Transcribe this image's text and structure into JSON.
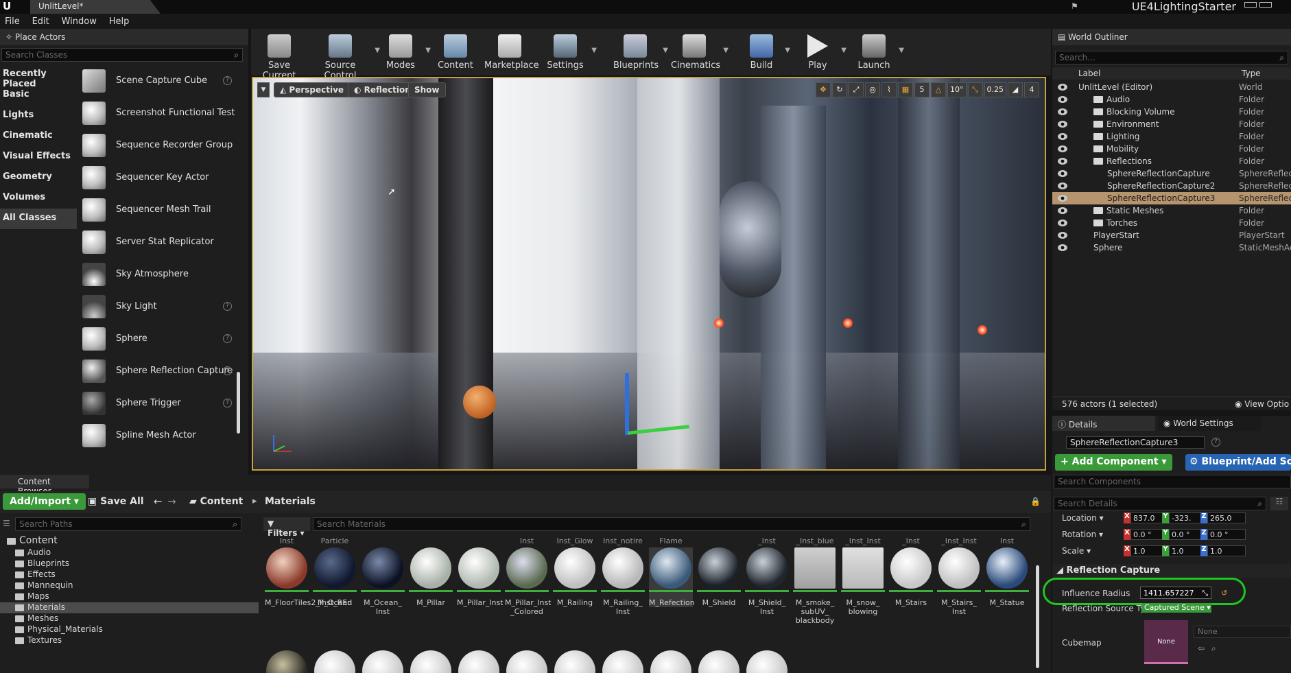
{
  "titlebar": {
    "tab": "UnlitLevel*",
    "project": "UE4LightingStarter"
  },
  "menu": [
    "File",
    "Edit",
    "Window",
    "Help"
  ],
  "place_actors": {
    "title": "Place Actors",
    "search_placeholder": "Search Classes",
    "categories": [
      "Recently Placed",
      "Basic",
      "Lights",
      "Cinematic",
      "Visual Effects",
      "Geometry",
      "Volumes",
      "All Classes"
    ],
    "items": [
      "Scene Capture Cube",
      "Screenshot Functional Test",
      "Sequence Recorder Group",
      "Sequencer Key Actor",
      "Sequencer Mesh Trail",
      "Server Stat Replicator",
      "Sky Atmosphere",
      "Sky Light",
      "Sphere",
      "Sphere Reflection Capture",
      "Sphere Trigger",
      "Spline Mesh Actor"
    ]
  },
  "toolbar": [
    "Save Current",
    "Source Control",
    "Modes",
    "Content",
    "Marketplace",
    "Settings",
    "Blueprints",
    "Cinematics",
    "Build",
    "Play",
    "Launch"
  ],
  "viewport": {
    "perspective": "Perspective",
    "reflections": "Reflections",
    "show": "Show",
    "grid": "5",
    "angle": "10°",
    "scale": "0.25",
    "cam_speed": "4"
  },
  "world_outliner": {
    "title": "World Outliner",
    "search_placeholder": "Search...",
    "col_label": "Label",
    "col_type": "Type",
    "rows": [
      {
        "label": "UnlitLevel (Editor)",
        "type": "World"
      },
      {
        "label": "Audio",
        "type": "Folder"
      },
      {
        "label": "Blocking Volume",
        "type": "Folder"
      },
      {
        "label": "Environment",
        "type": "Folder"
      },
      {
        "label": "Lighting",
        "type": "Folder"
      },
      {
        "label": "Mobility",
        "type": "Folder"
      },
      {
        "label": "Reflections",
        "type": "Folder"
      },
      {
        "label": "SphereReflectionCapture",
        "type": "SphereReflect"
      },
      {
        "label": "SphereReflectionCapture2",
        "type": "SphereReflect"
      },
      {
        "label": "SphereReflectionCapture3",
        "type": "SphereReflect"
      },
      {
        "label": "Static Meshes",
        "type": "Folder"
      },
      {
        "label": "Torches",
        "type": "Folder"
      },
      {
        "label": "PlayerStart",
        "type": "PlayerStart"
      },
      {
        "label": "Sphere",
        "type": "StaticMeshAc"
      }
    ],
    "status": "576 actors (1 selected)",
    "view_options": "View Optio"
  },
  "details": {
    "tab_details": "Details",
    "tab_world": "World Settings",
    "actor_name": "SphereReflectionCapture3",
    "add_component": "+ Add Component",
    "blueprint": "Blueprint/Add Scri",
    "search_components": "Search Components",
    "search_details": "Search Details",
    "location_label": "Location",
    "rotation_label": "Rotation",
    "scale_label": "Scale",
    "location": [
      "837.0",
      "-323.",
      "265.0"
    ],
    "rotation": [
      "0.0 °",
      "0.0 °",
      "0.0 °"
    ],
    "scale": [
      "1.0",
      "1.0",
      "1.0"
    ],
    "section": "Reflection Capture",
    "influence_label": "Influence Radius",
    "influence_value": "1411.657227",
    "source_label": "Reflection Source Typ",
    "source_value": "Captured Scene",
    "cubemap_label": "Cubemap",
    "cubemap_none": "None",
    "cubemap_picker": "None",
    "highlight_color": "#1ec81e"
  },
  "content_browser": {
    "title": "Content Browser",
    "add_import": "Add/Import",
    "save_all": "Save All",
    "crumb_content": "Content",
    "crumb_materials": "Materials",
    "search_paths": "Search Paths",
    "filters": "Filters",
    "search_materials": "Search Materials",
    "tree": [
      "Content",
      "Audio",
      "Blueprints",
      "Effects",
      "Mannequin",
      "Maps",
      "Materials",
      "Meshes",
      "Physical_Materials",
      "Textures"
    ],
    "top_labels": [
      "Inst",
      "Particle",
      "",
      "",
      "",
      "Inst",
      "Inst_Glow",
      "Inst_notire",
      "Flame",
      "",
      "_Inst",
      "_Inst_blue",
      "_Inst_Inst",
      "_Inst",
      "_Inst_Inst",
      "Inst"
    ],
    "assets": [
      "M_FloorTiles2_Inst_REd",
      "M_Ocean",
      "M_Ocean_ Inst",
      "M_Pillar",
      "M_Pillar_Inst",
      "M_Pillar_Inst _Colored",
      "M_Railing",
      "M_Railing_ Inst",
      "M_Refection",
      "M_Shield",
      "M_Shield_ Inst",
      "M_smoke_ subUV_ blackbody",
      "M_snow_ blowing",
      "M_Stairs",
      "M_Stairs_ Inst",
      "M_Statue"
    ]
  }
}
